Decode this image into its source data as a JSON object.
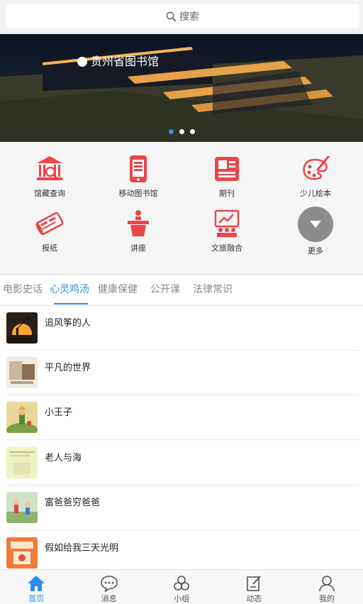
{
  "search": {
    "placeholder": "搜索"
  },
  "banner": {
    "sign_text": "贵州省图书馆",
    "slide_count": 3,
    "active_slide": 0
  },
  "grid": [
    {
      "label": "馆藏查询",
      "icon": "library-building-icon"
    },
    {
      "label": "移动图书馆",
      "icon": "mobile-phone-book-icon"
    },
    {
      "label": "期刊",
      "icon": "newspaper-icon"
    },
    {
      "label": "少儿绘本",
      "icon": "paint-palette-icon"
    },
    {
      "label": "报纸",
      "icon": "rolled-newspaper-icon"
    },
    {
      "label": "讲座",
      "icon": "lecture-podium-icon"
    },
    {
      "label": "文旅融合",
      "icon": "presentation-board-icon"
    },
    {
      "label": "更多",
      "icon": "chevron-down-icon"
    }
  ],
  "tabs": [
    {
      "label": "电影史话"
    },
    {
      "label": "心灵鸡汤"
    },
    {
      "label": "健康保健"
    },
    {
      "label": "公开课"
    },
    {
      "label": "法律常识"
    }
  ],
  "active_tab": 1,
  "list": [
    {
      "title": "追风筝的人"
    },
    {
      "title": "平凡的世界"
    },
    {
      "title": "小王子"
    },
    {
      "title": "老人与海"
    },
    {
      "title": "富爸爸穷爸爸"
    },
    {
      "title": "假如给我三天光明"
    }
  ],
  "tabbar": [
    {
      "label": "首页",
      "icon": "home-icon"
    },
    {
      "label": "消息",
      "icon": "chat-bubble-icon"
    },
    {
      "label": "小组",
      "icon": "group-icon"
    },
    {
      "label": "动态",
      "icon": "edit-note-icon"
    },
    {
      "label": "我的",
      "icon": "user-icon"
    }
  ],
  "colors": {
    "accent": "#2e8de8",
    "icon_red": "#e8464a",
    "more_gray": "#8c8c8c"
  }
}
